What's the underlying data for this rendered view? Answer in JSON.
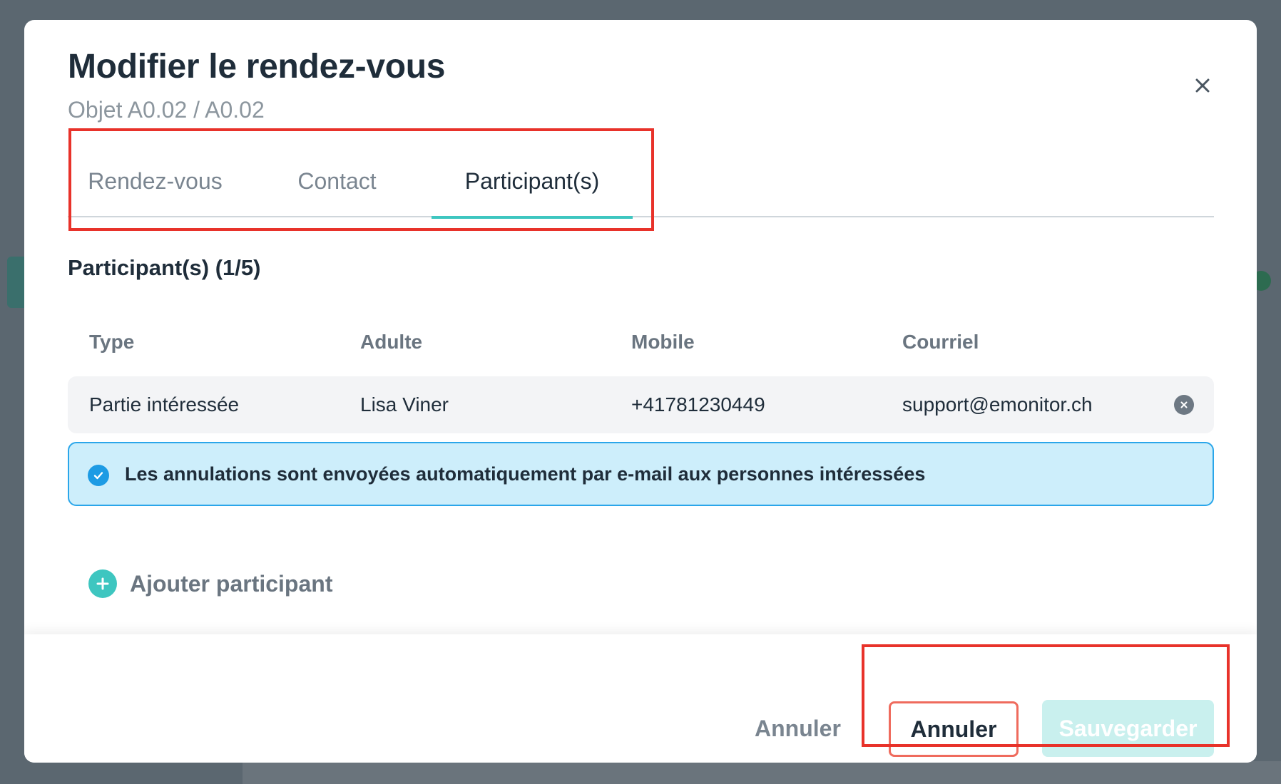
{
  "modal": {
    "title": "Modifier le rendez-vous",
    "subtitle": "Objet A0.02 / A0.02"
  },
  "tabs": [
    {
      "label": "Rendez-vous",
      "active": false
    },
    {
      "label": "Contact",
      "active": false
    },
    {
      "label": "Participant(s)",
      "active": true
    }
  ],
  "participants": {
    "section_title": "Participant(s) (1/5)",
    "columns": [
      "Type",
      "Adulte",
      "Mobile",
      "Courriel"
    ],
    "rows": [
      {
        "type": "Partie intéressée",
        "adult": "Lisa Viner",
        "mobile": "+41781230449",
        "email": "support@emonitor.ch"
      }
    ]
  },
  "info": {
    "text": "Les annulations sont envoyées automatiquement par e-mail aux personnes intéressées"
  },
  "add_participant": {
    "label": "Ajouter participant"
  },
  "footer": {
    "cancel_text_label": "Annuler",
    "cancel_outline_label": "Annuler",
    "save_label": "Sauvegarder"
  },
  "colors": {
    "accent": "#3ec6c0",
    "highlight": "#e8322a",
    "info_bg": "#cdeefb",
    "info_border": "#2aa6ea"
  }
}
